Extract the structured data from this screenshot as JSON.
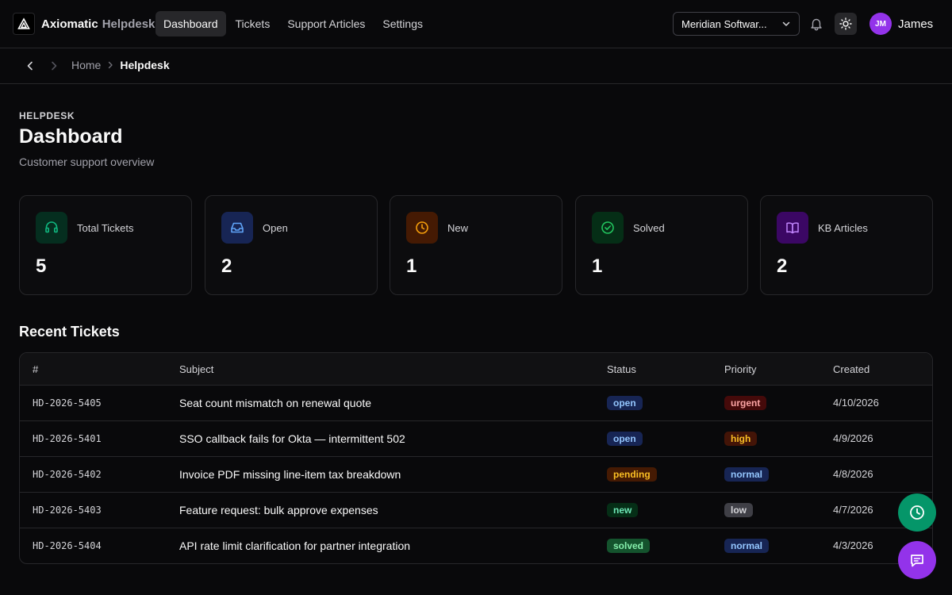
{
  "brand": {
    "name": "Axiomatic",
    "sub": "Helpdesk"
  },
  "nav": [
    {
      "label": "Dashboard",
      "active": true
    },
    {
      "label": "Tickets",
      "active": false
    },
    {
      "label": "Support Articles",
      "active": false
    },
    {
      "label": "Settings",
      "active": false
    }
  ],
  "org_select": {
    "value": "Meridian Softwar..."
  },
  "user": {
    "initials": "JM",
    "name": "James"
  },
  "breadcrumb": {
    "home": "Home",
    "current": "Helpdesk"
  },
  "page": {
    "eyebrow": "HELPDESK",
    "title": "Dashboard",
    "subtitle": "Customer support overview"
  },
  "stats": [
    {
      "label": "Total Tickets",
      "value": "5",
      "icon": "headset-icon",
      "color": "#10b981"
    },
    {
      "label": "Open",
      "value": "2",
      "icon": "inbox-icon",
      "color": "#3b82f6"
    },
    {
      "label": "New",
      "value": "1",
      "icon": "clock-icon",
      "color": "#f59e0b"
    },
    {
      "label": "Solved",
      "value": "1",
      "icon": "check-circle-icon",
      "color": "#22c55e"
    },
    {
      "label": "KB Articles",
      "value": "2",
      "icon": "book-open-icon",
      "color": "#a855f7"
    }
  ],
  "recent": {
    "title": "Recent Tickets",
    "columns": [
      "#",
      "Subject",
      "Status",
      "Priority",
      "Created"
    ],
    "rows": [
      {
        "id": "HD-2026-5405",
        "subject": "Seat count mismatch on renewal quote",
        "status": "open",
        "priority": "urgent",
        "created": "4/10/2026"
      },
      {
        "id": "HD-2026-5401",
        "subject": "SSO callback fails for Okta — intermittent 502",
        "status": "open",
        "priority": "high",
        "created": "4/9/2026"
      },
      {
        "id": "HD-2026-5402",
        "subject": "Invoice PDF missing line-item tax breakdown",
        "status": "pending",
        "priority": "normal",
        "created": "4/8/2026"
      },
      {
        "id": "HD-2026-5403",
        "subject": "Feature request: bulk approve expenses",
        "status": "new",
        "priority": "low",
        "created": "4/7/2026"
      },
      {
        "id": "HD-2026-5404",
        "subject": "API rate limit clarification for partner integration",
        "status": "solved",
        "priority": "normal",
        "created": "4/3/2026"
      }
    ]
  },
  "badge_colors": {
    "open": {
      "bg": "#172554",
      "fg": "#93c5fd"
    },
    "pending": {
      "bg": "#451a03",
      "fg": "#fbbf24"
    },
    "new": {
      "bg": "#052e16",
      "fg": "#6ee7b7"
    },
    "solved": {
      "bg": "#14532d",
      "fg": "#86efac"
    },
    "urgent": {
      "bg": "#450a0a",
      "fg": "#fca5a5"
    },
    "high": {
      "bg": "#431407",
      "fg": "#fbbf24"
    },
    "normal": {
      "bg": "#172554",
      "fg": "#93c5fd"
    },
    "low": {
      "bg": "#3f3f46",
      "fg": "#d4d4d8"
    }
  },
  "fabs": [
    {
      "icon": "clock-icon",
      "color": "#059669"
    },
    {
      "icon": "chat-icon",
      "color": "#9333ea"
    }
  ]
}
